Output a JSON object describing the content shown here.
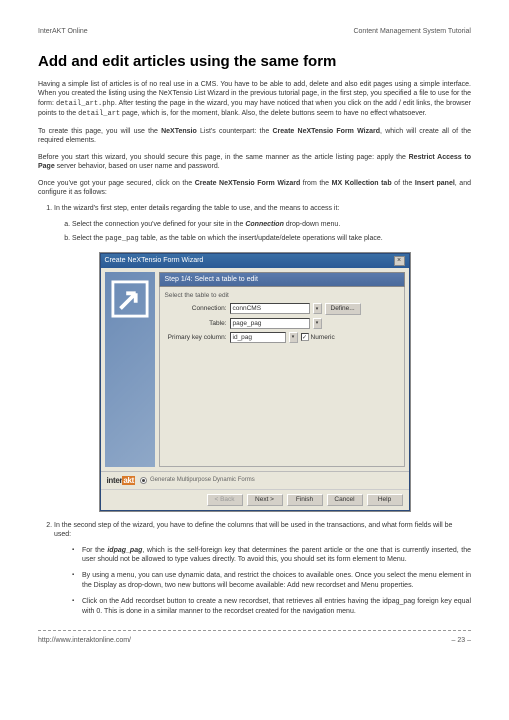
{
  "header": {
    "left": "InterAKT Online",
    "right": "Content Management System Tutorial"
  },
  "title": "Add and edit articles using the same form",
  "p1a": "Having a simple list of articles is of no real use in a CMS. You have to be able to add, delete  and also edit pages using a simple interface. When you created the listing using the NeXTensio List Wizard in the previous tutorial page, in the first step, you specified a file to use for the form: ",
  "p1code1": "detail_art.php",
  "p1b": ". After testing the page in the wizard, you may have noticed that when you click on the add / edit links, the browser points to the ",
  "p1code2": "detail_art",
  "p1c": " page, which is, for the moment, blank. Also, the delete buttons seem to have no effect whatsoever.",
  "p2a": "To create this page, you will use the ",
  "p2b1": "NeXTensio",
  "p2b": " List's counterpart: the ",
  "p2b2": "Create NeXTensio Form Wizard",
  "p2c": ", which will create all of the required elements.",
  "p3a": "Before you start this wizard, you should secure this page, in the same manner as the article listing page: apply the ",
  "p3b1": "Restrict Access to Page",
  "p3b": " server behavior, based on user name and password.",
  "p4a": "Once you've got your page secured, click on the ",
  "p4b1": "Create NeXTensio Form Wizard",
  "p4b": " from the ",
  "p4b2": "MX Kollection tab",
  "p4c": " of the ",
  "p4b3": "Insert panel",
  "p4d": ", and configure it as follows:",
  "li1": "In the wizard's first step, enter details regarding the table to use, and the means to access it:",
  "li1a_a": "Select the connection you've defined for your site in the ",
  "li1a_bi": "Connection",
  "li1a_b": " drop-down menu.",
  "li1b_a": "Select the ",
  "li1b_code": "page_pag",
  "li1b_b": " table, as the table on which the insert/update/delete operations will take place.",
  "wizard": {
    "title": "Create NeXTensio Form Wizard",
    "step": "Step 1/4: Select a table to edit",
    "group": "Select the table to edit",
    "conn_label": "Connection:",
    "conn_value": "connCMS",
    "define": "Define...",
    "table_label": "Table:",
    "table_value": "page_pag",
    "pk_label": "Primary key column:",
    "pk_value": "id_pag",
    "numeric": "Numeric",
    "logo": "interakt",
    "radio": "Generate Multipurpose Dynamic Forms",
    "back": "< Back",
    "next": "Next >",
    "finish": "Finish",
    "cancel": "Cancel",
    "help": "Help"
  },
  "li2": "In the second step of the wizard, you have to define the columns that will be used in the transactions, and what form fields will be used:",
  "b1a": "For the ",
  "b1bi": "idpag_pag",
  "b1b": ", which is the self-foreign key that determines the parent article or the one that is currently inserted, the user should not be allowed to type values directly. To avoid this, you should set its form element to Menu.",
  "b2": "By using a menu, you can use dynamic data, and restrict the choices to available ones. Once you select the menu element in the Display as drop-down, two new buttons will become available: Add new recordset and Menu properties.",
  "b3": "Click on the Add recordset button to create a new recordset, that retrieves all entries having the idpag_pag foreign key equal with 0. This is done in a similar manner to the recordset created for the navigation menu.",
  "footer": {
    "url": "http://www.interaktonline.com/",
    "page": "– 23 –"
  }
}
